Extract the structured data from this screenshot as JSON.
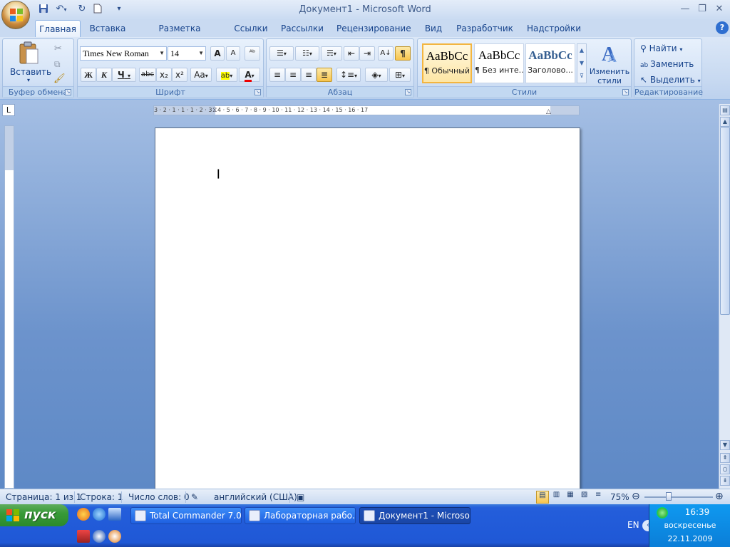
{
  "window": {
    "title": "Документ1 - Microsoft Word"
  },
  "qat": {
    "save": "save-icon",
    "undo": "undo-icon",
    "redo": "redo-icon",
    "new": "new-doc-icon",
    "customize": "▾"
  },
  "tabs": [
    "Главная",
    "Вставка",
    "Разметка страницы",
    "Ссылки",
    "Рассылки",
    "Рецензирование",
    "Вид",
    "Разработчик",
    "Надстройки"
  ],
  "ribbon": {
    "clipboard": {
      "paste": "Вставить",
      "label": "Буфер обмена"
    },
    "font": {
      "name": "Times New Roman",
      "size": "14",
      "label": "Шрифт",
      "bold": "Ж",
      "italic": "К",
      "underline": "Ч",
      "strike": "abc",
      "sub": "x₂",
      "sup": "x²",
      "case": "Aa",
      "grow": "A",
      "shrink": "A"
    },
    "paragraph": {
      "label": "Абзац",
      "pilcrow": "¶"
    },
    "styles": {
      "label": "Стили",
      "items": [
        {
          "sample": "AaBbCc",
          "name": "¶ Обычный"
        },
        {
          "sample": "AaBbCc",
          "name": "¶ Без инте..."
        },
        {
          "sample": "AaBbCc",
          "name": "Заголово..."
        }
      ],
      "change": "Изменить стили"
    },
    "editing": {
      "label": "Редактирование",
      "find": "Найти",
      "replace": "Заменить",
      "select": "Выделить"
    }
  },
  "ruler": {
    "text": "3 · 2 · 1 · 1 · 1 · 2 · 3 · 4 · 5 · 6 · 7 · 8 · 9 · 10 · 11 · 12 · 13 · 14 · 15 · 16 · 17"
  },
  "status": {
    "page": "Страница: 1 из 1",
    "line": "Строка: 1",
    "words": "Число слов: 0",
    "lang": "английский (США)",
    "zoom": "75%"
  },
  "taskbar": {
    "start": "пуск",
    "tasks": [
      "Total Commander 7.0...",
      "Лабораторная рабо...",
      "Документ1 - Microso..."
    ],
    "lang": "EN",
    "time": "16:39",
    "day": "воскресенье",
    "date": "22.11.2009"
  }
}
